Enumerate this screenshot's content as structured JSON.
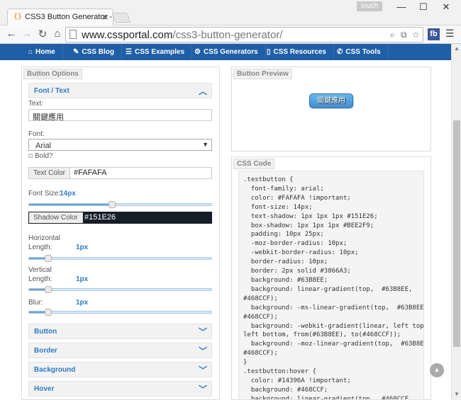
{
  "browser": {
    "tab_title": "CSS3 Button Generator -",
    "tab_favicon": "{}",
    "tab_close": "×",
    "profile_label": "touch",
    "window_controls": [
      "—",
      "☐",
      "✕"
    ],
    "url_host": "www.cssportal.com",
    "url_path": "/css3-button-generator/",
    "ext_label": "fb"
  },
  "site_nav": [
    {
      "icon": "home-icon",
      "glyph": "⌂",
      "label": "Home"
    },
    {
      "icon": "pencil-icon",
      "glyph": "✎",
      "label": "CSS Blog"
    },
    {
      "icon": "list-icon",
      "glyph": "☰",
      "label": "CSS Examples"
    },
    {
      "icon": "gear-icon",
      "glyph": "⚙",
      "label": "CSS Generators"
    },
    {
      "icon": "file-icon",
      "glyph": "▯",
      "label": "CSS Resources"
    },
    {
      "icon": "wrench-icon",
      "glyph": "✆",
      "label": "CSS Tools"
    }
  ],
  "options": {
    "panel_title": "Button Options",
    "font_section": "Font / Text",
    "text_label": "Text:",
    "text_value": "關鍵應用",
    "font_label": "Font:",
    "font_value": "Arial",
    "bold_label": "Bold?",
    "text_color_label": "Text Color",
    "text_color_value": "#FAFAFA",
    "font_size_label": "Font Size:",
    "font_size_value": "14px",
    "shadow_color_label": "Shadow Color",
    "shadow_color_value": "#151E26",
    "horizontal_label_1": "Horizontal",
    "horizontal_label_2": "Length:",
    "horizontal_value": "1px",
    "vertical_label_1": "Vertical",
    "vertical_label_2": "Length:",
    "vertical_value": "1px",
    "blur_label": "Blur:",
    "blur_value": "1px",
    "sections": [
      "Button",
      "Border",
      "Background",
      "Hover"
    ]
  },
  "preview": {
    "panel_title": "Button Preview",
    "button_label": "關鍵應用"
  },
  "code": {
    "panel_title": "CSS Code",
    "text": ".testbutton {\n  font-family: arial;\n  color: #FAFAFA !important;\n  font-size: 14px;\n  text-shadow: 1px 1px 1px #151E26;\n  box-shadow: 1px 1px 1px #BEE2F9;\n  padding: 10px 25px;\n  -moz-border-radius: 10px;\n  -webkit-border-radius: 10px;\n  border-radius: 10px;\n  border: 2px solid #3866A3;\n  background: #63B8EE;\n  background: linear-gradient(top,  #63B8EE,\n#468CCF);\n  background: -ms-linear-gradient(top,  #63B8EE,\n#468CCF);\n  background: -webkit-gradient(linear, left top,\nleft bottom, from(#63B8EE), to(#468CCF));\n  background: -moz-linear-gradient(top,  #63B8EE,\n#468CCF);\n}\n.testbutton:hover {\n  color: #14396A !important;\n  background: #468CCF;\n  background: linear-gradient(top,  #468CCF,"
  },
  "colors": {
    "nav_bg": "#1f5fa8",
    "accent": "#2d7bc4",
    "shadow_color": "#151e26"
  },
  "sliders": {
    "font_size_fraction": 0.45,
    "horizontal_fraction": 0.1,
    "vertical_fraction": 0.1,
    "blur_fraction": 0.1
  }
}
